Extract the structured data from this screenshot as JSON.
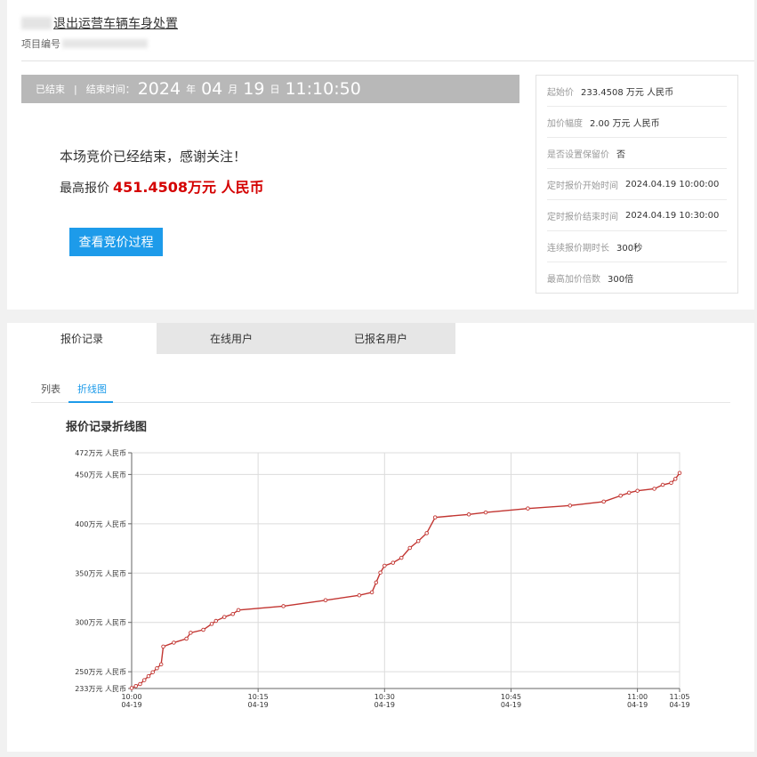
{
  "header": {
    "title": "退出运营车辆车身处置",
    "project_label": "项目编号"
  },
  "status": {
    "state": "已结束",
    "end_label": "结束时间：",
    "year": "2024",
    "year_unit": "年",
    "month": "04",
    "month_unit": "月",
    "day": "19",
    "day_unit": "日",
    "time": "11:10:50"
  },
  "result": {
    "message": "本场竞价已经结束，感谢关注！",
    "top_bid_label": "最高报价",
    "top_bid_value": "451.4508万元 人民币",
    "view_button": "查看竞价过程"
  },
  "info": [
    {
      "label": "起始价",
      "value": "233.4508 万元 人民币"
    },
    {
      "label": "加价幅度",
      "value": "2.00 万元 人民币"
    },
    {
      "label": "是否设置保留价",
      "value": "否"
    },
    {
      "label": "定时报价开始时间",
      "value": "2024.04.19 10:00:00"
    },
    {
      "label": "定时报价结束时间",
      "value": "2024.04.19 10:30:00"
    },
    {
      "label": "连续报价期时长",
      "value": "300秒"
    },
    {
      "label": "最高加价倍数",
      "value": "300倍"
    }
  ],
  "tabs": [
    {
      "label": "报价记录",
      "active": true
    },
    {
      "label": "在线用户",
      "active": false
    },
    {
      "label": "已报名用户",
      "active": false
    }
  ],
  "subtabs": [
    {
      "label": "列表",
      "active": false
    },
    {
      "label": "折线图",
      "active": true
    }
  ],
  "chart_title": "报价记录折线图",
  "colors": {
    "accent": "#1d9bea",
    "price_red": "#d40000",
    "line": "#c23531",
    "status_bar": "#b8b8b8"
  },
  "chart_data": {
    "type": "line",
    "title": "报价记录折线图",
    "y_unit": "万元 人民币",
    "ylim": [
      233,
      472
    ],
    "y_ticks": [
      {
        "value": 233,
        "label": "233万元 人民币"
      },
      {
        "value": 250,
        "label": "250万元 人民币"
      },
      {
        "value": 300,
        "label": "300万元 人民币"
      },
      {
        "value": 350,
        "label": "350万元 人民币"
      },
      {
        "value": 400,
        "label": "400万元 人民币"
      },
      {
        "value": 450,
        "label": "450万元 人民币"
      },
      {
        "value": 472,
        "label": "472万元 人民币"
      }
    ],
    "x_ticks": [
      {
        "time": "10:00",
        "date": "04-19"
      },
      {
        "time": "10:15",
        "date": "04-19"
      },
      {
        "time": "10:30",
        "date": "04-19"
      },
      {
        "time": "10:45",
        "date": "04-19"
      },
      {
        "time": "11:00",
        "date": "04-19"
      },
      {
        "time": "11:05",
        "date": "04-19"
      }
    ],
    "grid": true,
    "series": [
      {
        "points": [
          [
            "10:00",
            233.5
          ],
          [
            "10:00:30",
            235.5
          ],
          [
            "10:01",
            237.5
          ],
          [
            "10:01:30",
            241.5
          ],
          [
            "10:02",
            245.5
          ],
          [
            "10:02:30",
            249.5
          ],
          [
            "10:03",
            253.5
          ],
          [
            "10:03:30",
            257.5
          ],
          [
            "10:03:45",
            275.5
          ],
          [
            "10:05",
            279.5
          ],
          [
            "10:06:30",
            283.5
          ],
          [
            "10:07",
            289.5
          ],
          [
            "10:08:30",
            292.5
          ],
          [
            "10:09:30",
            298.5
          ],
          [
            "10:10",
            301.5
          ],
          [
            "10:11",
            305.5
          ],
          [
            "10:12",
            308.5
          ],
          [
            "10:12:40",
            312.5
          ],
          [
            "10:18",
            316.5
          ],
          [
            "10:23",
            322.5
          ],
          [
            "10:27",
            327.5
          ],
          [
            "10:28:30",
            330.5
          ],
          [
            "10:29",
            340.5
          ],
          [
            "10:29:30",
            350.5
          ],
          [
            "10:30",
            357.5
          ],
          [
            "10:31",
            360.5
          ],
          [
            "10:32",
            365.5
          ],
          [
            "10:33",
            375.5
          ],
          [
            "10:34",
            382.5
          ],
          [
            "10:35",
            390.5
          ],
          [
            "10:36",
            406.5
          ],
          [
            "10:40",
            409.5
          ],
          [
            "10:42",
            411.5
          ],
          [
            "10:47",
            415.5
          ],
          [
            "10:52",
            418.5
          ],
          [
            "10:56",
            422.5
          ],
          [
            "10:58",
            428.5
          ],
          [
            "10:59",
            431.5
          ],
          [
            "11:00",
            433.5
          ],
          [
            "11:02",
            435.5
          ],
          [
            "11:03",
            439.5
          ],
          [
            "11:04",
            441.5
          ],
          [
            "11:04:30",
            445.5
          ],
          [
            "11:05",
            451.5
          ]
        ]
      }
    ]
  }
}
